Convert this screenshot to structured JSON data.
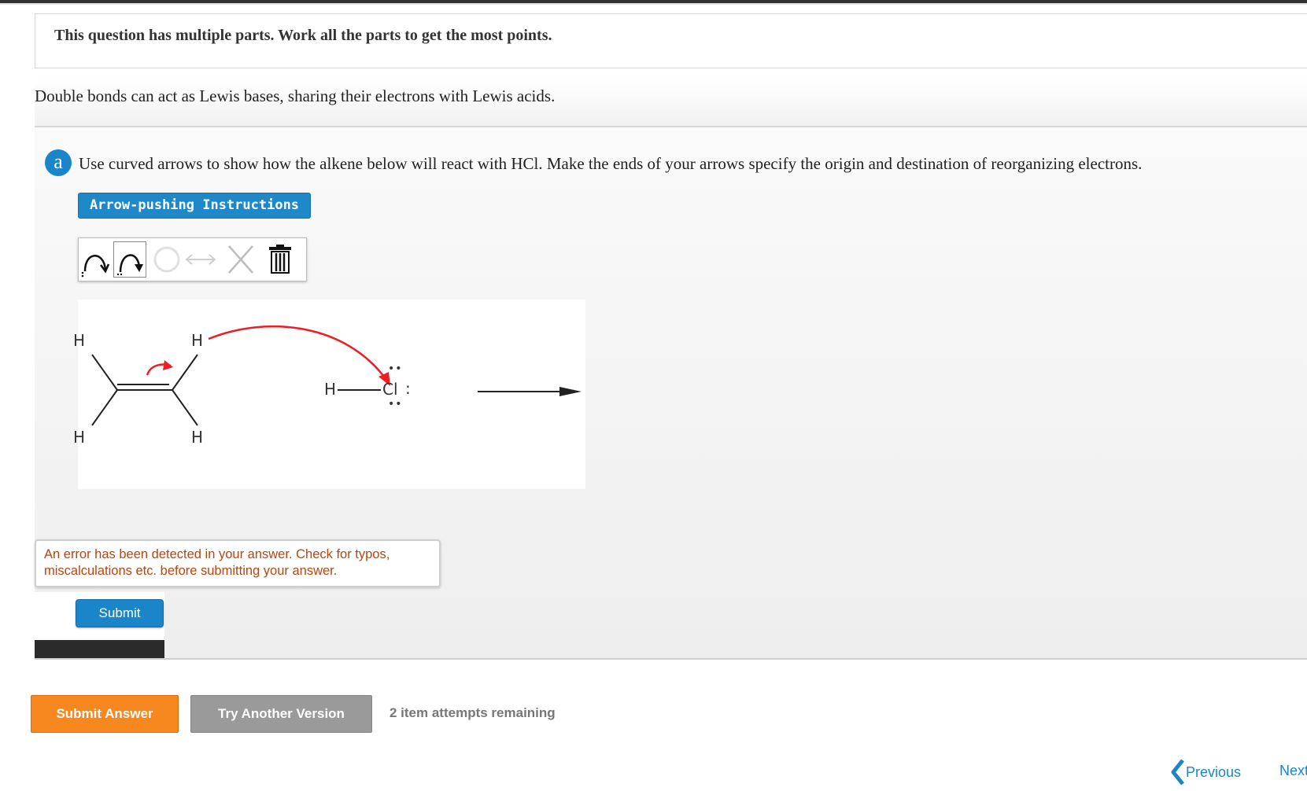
{
  "notice": "This question has multiple parts. Work all the parts to get the most points.",
  "intro": "Double bonds can act as Lewis bases, sharing their electrons with Lewis acids.",
  "part": {
    "badge": "a",
    "prompt": "Use curved arrows to show how the alkene below will react with HCl. Make the ends of your arrows specify the origin and destination of reorganizing electrons.",
    "instructions_button": "Arrow-pushing Instructions"
  },
  "toolbar": {
    "tools": [
      "double-headed-curved-arrow-icon",
      "single-headed-curved-arrow-icon",
      "undo-icon",
      "resize-icon",
      "erase-icon",
      "trash-icon"
    ]
  },
  "molecule": {
    "alkene_atoms": [
      "H",
      "H",
      "H",
      "H"
    ],
    "hcl_h": "H",
    "hcl_cl": "Cl",
    "lone_pair_dots": ":"
  },
  "error_message": "An error has been detected in your answer. Check for typos, miscalculations etc. before submitting your answer.",
  "submit_label": "Submit",
  "footer": {
    "submit_answer": "Submit Answer",
    "try_another": "Try Another Version",
    "attempts": "2 item attempts remaining"
  },
  "nav": {
    "previous": "Previous",
    "next": "Next"
  },
  "colors": {
    "accent_blue": "#1a86c9",
    "orange": "#f7871f",
    "gray_button": "#9a9a9a",
    "error_text": "#b5460f",
    "arrow_red": "#ee1c24"
  }
}
